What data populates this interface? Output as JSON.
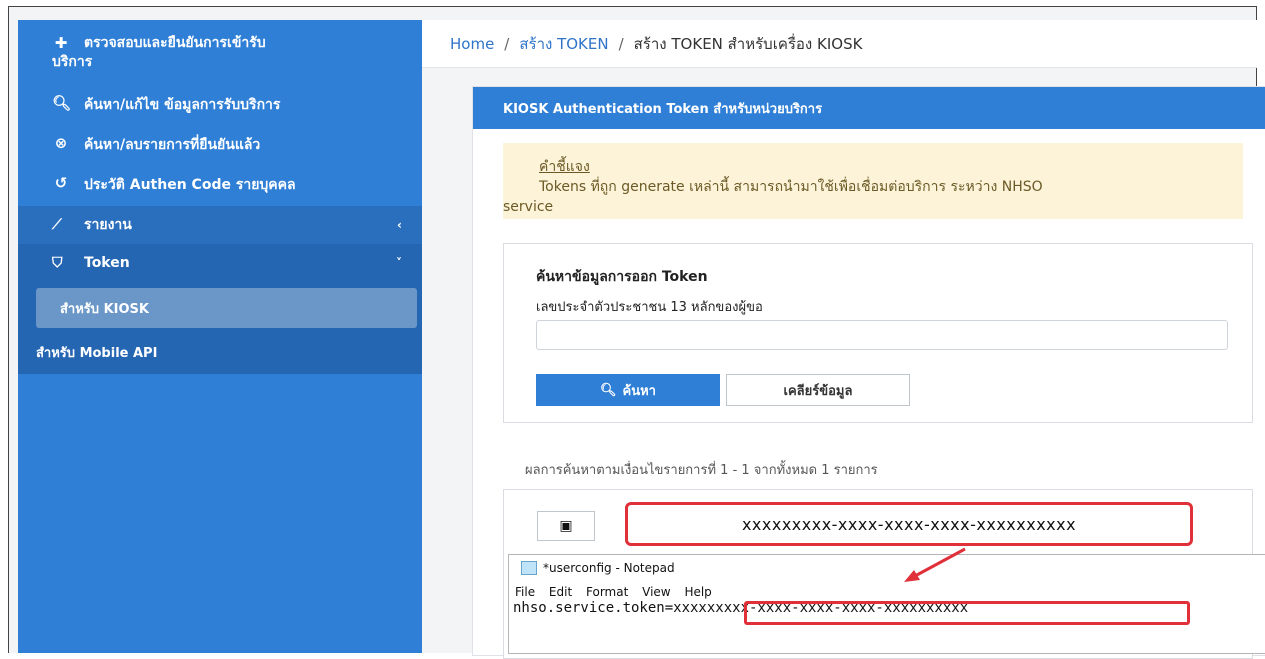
{
  "sidebar": {
    "items": [
      {
        "icon": "medical-cross-icon",
        "glyph": "✚",
        "label": "ตรวจสอบและยืนยันการเข้ารับ",
        "label2": "บริการ"
      },
      {
        "icon": "search-icon",
        "glyph": "🔍︎",
        "label": "ค้นหา/แก้ไข ข้อมูลการรับบริการ"
      },
      {
        "icon": "cancel-circle-icon",
        "glyph": "⊗",
        "label": "ค้นหา/ลบรายการที่ยืนยันแล้ว"
      },
      {
        "icon": "history-icon",
        "glyph": "↺",
        "label": "ประวัติ Authen Code รายบุคคล"
      }
    ],
    "report": {
      "icon": "chart-icon",
      "glyph": "⟋",
      "label": "รายงาน",
      "chev": "‹"
    },
    "token": {
      "icon": "shield-icon",
      "glyph": "⛉",
      "label": "Token",
      "chev": "˅"
    },
    "sub_active": "สำหรับ KIOSK",
    "sub_mobile": "สำหรับ Mobile API"
  },
  "breadcrumb": {
    "home": "Home",
    "sep": "/",
    "level1": "สร้าง TOKEN",
    "current": "สร้าง TOKEN สำหรับเครื่อง KIOSK"
  },
  "card": {
    "header": "KIOSK Authentication Token สำหรับหน่วยบริการ",
    "note_title": "คำชี้แจง",
    "note_line1": "Tokens ที่ถูก generate เหล่านี้ สามารถนำมาใช้เพื่อเชื่อมต่อบริการ ระหว่าง NHSO",
    "note_line2": "service",
    "search_title": "ค้นหาข้อมูลการออก Token",
    "search_label": "เลขประจำตัวประชาชน 13 หลักของผู้ขอ",
    "search_placeholder": "",
    "search_btn": "ค้นหา",
    "clear_btn": "เคลียร์ข้อมูล",
    "result_text": "ผลการค้นหาตามเงื่อนไขรายการที่ 1 - 1 จากทั้งหมด 1 รายการ",
    "token_value": "xxxxxxxxx-xxxx-xxxx-xxxx-xxxxxxxxxx"
  },
  "notepad": {
    "title": "*userconfig - Notepad",
    "menu": [
      "File",
      "Edit",
      "Format",
      "View",
      "Help"
    ],
    "content": "nhso.service.token=xxxxxxxxx-xxxx-xxxx-xxxx-xxxxxxxxxx"
  },
  "colors": {
    "sidebar": "#2f7fd6",
    "highlight": "#e0303a",
    "note_bg": "#fcf3d9"
  }
}
